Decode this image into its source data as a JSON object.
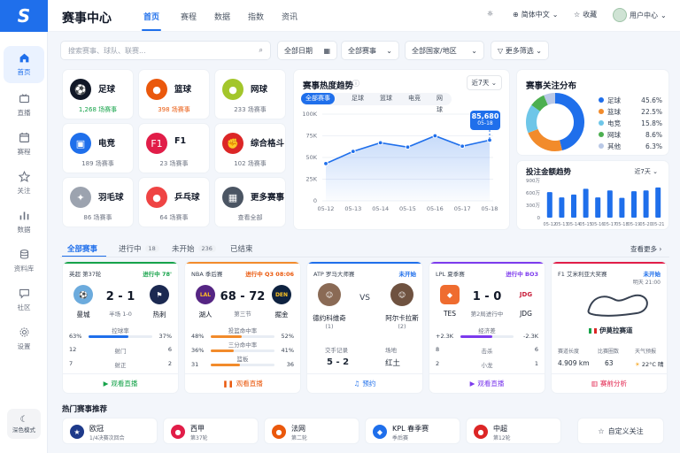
{
  "app": {
    "logo": "S",
    "title": "赛事中心"
  },
  "topnav": [
    "首页",
    "赛程",
    "数据",
    "指数",
    "资讯"
  ],
  "topbar": {
    "lang": "简体中文",
    "fav": "收藏",
    "user": "用户中心"
  },
  "sidebar": [
    "首页",
    "直播",
    "赛程",
    "关注",
    "数据",
    "资料库",
    "社区",
    "设置"
  ],
  "dark_mode": "深色模式",
  "search": {
    "placeholder": "搜索赛事、球队、联赛..."
  },
  "filters": {
    "date": "全部日期",
    "event": "全部赛事",
    "region": "全部国家/地区",
    "more": "更多筛选"
  },
  "sports": [
    {
      "name": "足球",
      "count": "1,268 场赛事",
      "color": "#16a34a"
    },
    {
      "name": "篮球",
      "count": "398 场赛事",
      "color": "#ea580c"
    },
    {
      "name": "网球",
      "count": "233 场赛事",
      "color": "#6b7280"
    },
    {
      "name": "电竞",
      "count": "189 场赛事",
      "color": "#6b7280"
    },
    {
      "name": "F1",
      "count": "23 场赛事",
      "color": "#6b7280"
    },
    {
      "name": "综合格斗",
      "count": "102 场赛事",
      "color": "#6b7280"
    },
    {
      "name": "羽毛球",
      "count": "86 场赛事",
      "color": "#6b7280"
    },
    {
      "name": "乒乓球",
      "count": "64 场赛事",
      "color": "#6b7280"
    },
    {
      "name": "更多赛事",
      "count": "查看全部",
      "color": "#6b7280"
    }
  ],
  "trend": {
    "title": "赛事热度趋势",
    "range": "近7天",
    "tabs": [
      "全部赛事",
      "足球",
      "篮球",
      "电竞",
      "网球"
    ],
    "tooltip_value": "85,680",
    "tooltip_date": "05-18"
  },
  "chart_data": [
    {
      "type": "area",
      "title": "赛事热度趋势",
      "x": [
        "05-12",
        "05-13",
        "05-14",
        "05-15",
        "05-16",
        "05-17",
        "05-18"
      ],
      "values": [
        43000,
        57000,
        67000,
        62000,
        75000,
        63000,
        70000
      ],
      "yticks": [
        "100K",
        "75K",
        "50K",
        "25K",
        "0"
      ],
      "ylim": [
        0,
        100000
      ],
      "highlight": {
        "x": "05-18",
        "label": "85,680"
      }
    },
    {
      "type": "pie",
      "title": "赛事关注分布",
      "categories": [
        "足球",
        "篮球",
        "电竞",
        "网球",
        "其他"
      ],
      "values": [
        45.6,
        22.5,
        15.8,
        8.6,
        6.3
      ],
      "labels": [
        "45.6%",
        "22.5%",
        "15.8%",
        "8.6%",
        "6.3%"
      ],
      "colors": [
        "#1f6feb",
        "#f28b2b",
        "#6ec6e8",
        "#4caf50",
        "#b9c8e6"
      ]
    },
    {
      "type": "bar",
      "title": "投注金额趋势",
      "categories": [
        "05-12",
        "05-13",
        "05-14",
        "05-15",
        "05-16",
        "05-17",
        "05-18",
        "05-19",
        "05-20",
        "05-21"
      ],
      "values": [
        620,
        490,
        560,
        700,
        490,
        660,
        480,
        640,
        660,
        730
      ],
      "yticks": [
        "900万",
        "600万",
        "300万",
        "0"
      ],
      "ylim": [
        0,
        900
      ]
    }
  ],
  "distribution": {
    "title": "赛事关注分布"
  },
  "bets": {
    "title": "投注金额趋势",
    "range": "近7天"
  },
  "status_tabs": [
    {
      "label": "全部赛事",
      "count": ""
    },
    {
      "label": "进行中",
      "count": "18"
    },
    {
      "label": "未开始",
      "count": "236"
    },
    {
      "label": "已结束",
      "count": ""
    }
  ],
  "see_more": "查看更多 ›",
  "matches": [
    {
      "league": "英超 第37轮",
      "status": "进行中 78'",
      "home": "曼城",
      "away": "热刺",
      "score": "2 - 1",
      "sub": "半场 1-0",
      "stats": [
        {
          "l": "63%",
          "c": "控球率",
          "r": "37%"
        },
        {
          "l": "12",
          "c": "射门",
          "r": "6"
        },
        {
          "l": "7",
          "c": "射正",
          "r": "2"
        }
      ],
      "action": "观看直播"
    },
    {
      "league": "NBA 季后赛",
      "status": "进行中 Q3 08:06",
      "home": "湖人",
      "away": "掘金",
      "score": "68 - 72",
      "sub": "第三节",
      "stats": [
        {
          "l": "48%",
          "c": "投篮命中率",
          "r": "52%"
        },
        {
          "l": "36%",
          "c": "三分命中率",
          "r": "41%"
        },
        {
          "l": "31",
          "c": "篮板",
          "r": "36"
        }
      ],
      "action": "观看直播"
    },
    {
      "league": "ATP 罗马大师赛",
      "status": "未开始",
      "home": "德约科维奇",
      "away": "阿尔卡拉斯",
      "vs": "VS",
      "rank_home": "(1)",
      "rank_away": "(2)",
      "info": [
        {
          "k": "交手记录",
          "v": "5 - 2"
        },
        {
          "k": "场地",
          "v": "红土"
        }
      ],
      "action": "预约"
    },
    {
      "league": "LPL 夏季赛",
      "status": "进行中 BO3",
      "home": "TES",
      "away": "JDG",
      "score": "1 - 0",
      "sub": "第2局进行中",
      "stats": [
        {
          "l": "+2.3K",
          "c": "经济差",
          "r": "-2.3K"
        },
        {
          "l": "8",
          "c": "击杀",
          "r": "6"
        },
        {
          "l": "2",
          "c": "小龙",
          "r": "1"
        }
      ],
      "action": "观看直播"
    },
    {
      "league": "F1 艾米利亚大奖赛",
      "status": "未开始",
      "time": "明天 21:00",
      "circuit": "伊莫拉赛道",
      "info": [
        {
          "k": "赛道长度",
          "v": "4.909 km"
        },
        {
          "k": "比赛圈数",
          "v": "63"
        },
        {
          "k": "天气预报",
          "v": "22°C 晴"
        }
      ],
      "action": "赛前分析"
    }
  ],
  "hot": {
    "title": "热门赛事推荐",
    "items": [
      {
        "name": "欧冠",
        "sub": "1/4决赛次回合"
      },
      {
        "name": "西甲",
        "sub": "第37轮"
      },
      {
        "name": "法网",
        "sub": "第二轮"
      },
      {
        "name": "KPL 春季赛",
        "sub": "季后赛"
      },
      {
        "name": "中超",
        "sub": "第12轮"
      }
    ],
    "custom": "自定义关注"
  }
}
